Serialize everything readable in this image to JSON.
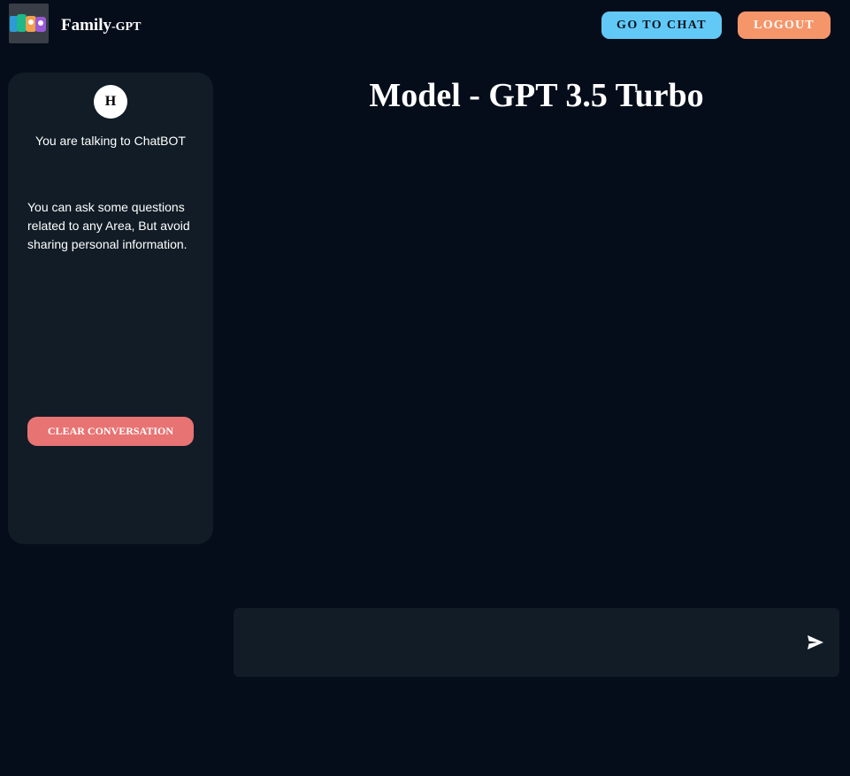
{
  "header": {
    "brand_main": "Family",
    "brand_sub": "-GPT",
    "go_to_chat_label": "GO TO CHAT",
    "logout_label": "LOGOUT",
    "logo_icon": "family-gpt-logo",
    "chat_button_color": "#62c9f6",
    "logout_button_color": "#f5956a"
  },
  "sidebar": {
    "avatar_initial": "H",
    "talking_to": "You are talking to ChatBOT",
    "info_text": "You can ask some questions related to any Area, But avoid sharing personal information.",
    "clear_label": "CLEAR CONVERSATION",
    "clear_button_color": "#e87373"
  },
  "main": {
    "model_title": "Model - GPT 3.5 Turbo",
    "input_value": "",
    "send_icon": "send-icon"
  },
  "colors": {
    "background": "#050d1a",
    "panel": "#111c26"
  }
}
